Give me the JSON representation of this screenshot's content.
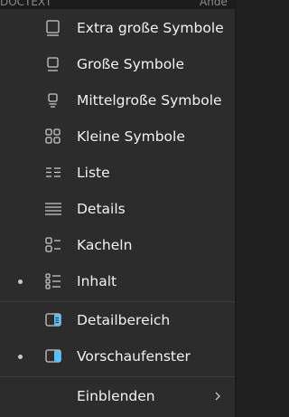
{
  "background_header": {
    "left_text": "DOCTEXT",
    "right_text": "Ände"
  },
  "menu": {
    "view_items": [
      {
        "label": "Extra große Symbole",
        "icon": "extra-large-icons-icon",
        "selected": false
      },
      {
        "label": "Große Symbole",
        "icon": "large-icons-icon",
        "selected": false
      },
      {
        "label": "Mittelgroße Symbole",
        "icon": "medium-icons-icon",
        "selected": false
      },
      {
        "label": "Kleine Symbole",
        "icon": "small-icons-icon",
        "selected": false
      },
      {
        "label": "Liste",
        "icon": "list-icon",
        "selected": false
      },
      {
        "label": "Details",
        "icon": "details-icon",
        "selected": false
      },
      {
        "label": "Kacheln",
        "icon": "tiles-icon",
        "selected": false
      },
      {
        "label": "Inhalt",
        "icon": "content-icon",
        "selected": true
      }
    ],
    "pane_items": [
      {
        "label": "Detailbereich",
        "icon": "details-pane-icon",
        "selected": false
      },
      {
        "label": "Vorschaufenster",
        "icon": "preview-pane-icon",
        "selected": true
      }
    ],
    "show_item": {
      "label": "Einblenden",
      "icon": "chevron-right-icon"
    }
  },
  "colors": {
    "menu_background": "#2c2c2c",
    "text": "#f2f2f2",
    "icon_stroke": "#c8c8c8",
    "accent": "#4cc2ff"
  }
}
